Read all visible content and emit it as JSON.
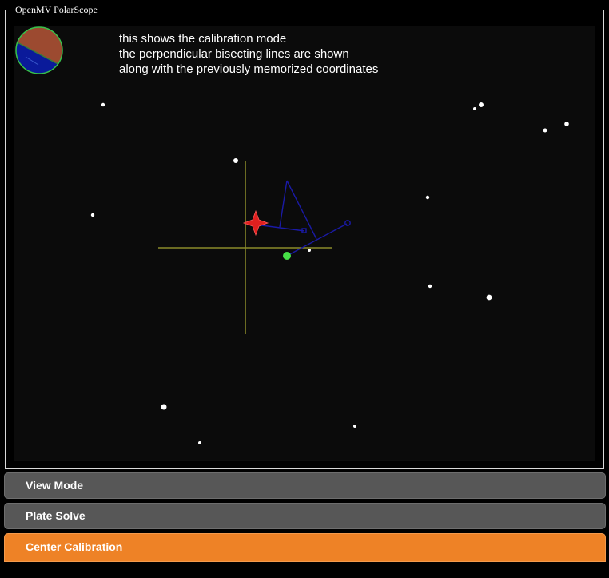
{
  "app": {
    "title": "OpenMV PolarScope"
  },
  "annotation": {
    "text": "this shows the calibration mode\nthe perpendicular bisecting lines are shown\nalong with the previously memorized coordinates"
  },
  "modes": [
    {
      "label": "View Mode",
      "active": false
    },
    {
      "label": "Plate Solve",
      "active": false
    },
    {
      "label": "Center Calibration",
      "active": true
    }
  ],
  "colors": {
    "accent": "#ee8226",
    "button": "#575757",
    "crosshair": "#8b8b2a",
    "calibration_lines": "#1a1aa6",
    "target_marker": "#e0201f",
    "center_dot": "#46e046"
  }
}
